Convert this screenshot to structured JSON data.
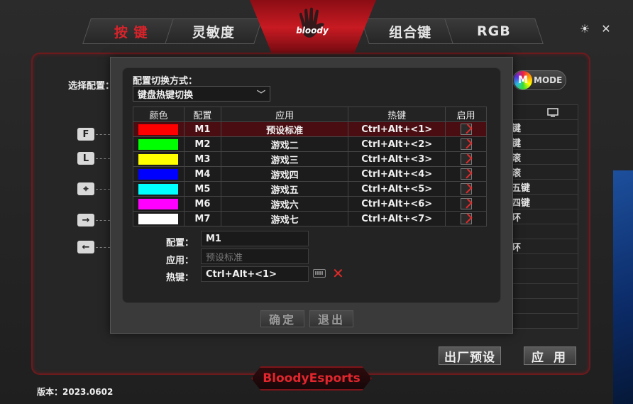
{
  "tabs": [
    {
      "label": "按 键",
      "active": true
    },
    {
      "label": "灵敏度",
      "active": false
    },
    {
      "label": "组合键",
      "active": false
    },
    {
      "label": "RGB",
      "active": false
    }
  ],
  "logo_text": "bloody",
  "select_config_label": "选择配置：",
  "side_keys": [
    "F",
    "L",
    "⌖",
    "→",
    "←"
  ],
  "mode_badge": {
    "icon": "M",
    "label": "MODE"
  },
  "right_list": [
    "键",
    "键",
    "滚",
    "滚",
    "五键",
    "四键",
    "环",
    "",
    "环",
    "",
    "",
    "",
    ""
  ],
  "factory_button": "出厂预设",
  "apply_button": "应 用",
  "brand": "BloodyEsports",
  "version": "版本：2023.0602",
  "modal": {
    "switch_mode_title": "配置切换方式：",
    "switch_mode_value": "键盘热键切换",
    "columns": [
      "颜色",
      "配置",
      "应用",
      "热键",
      "启用"
    ],
    "rows": [
      {
        "color": "#ff0000",
        "config": "M1",
        "app": "预设标准",
        "hotkey": "Ctrl+Alt+<1>",
        "enabled": true,
        "selected": true
      },
      {
        "color": "#00ff00",
        "config": "M2",
        "app": "游戏二",
        "hotkey": "Ctrl+Alt+<2>",
        "enabled": true,
        "selected": false
      },
      {
        "color": "#ffff00",
        "config": "M3",
        "app": "游戏三",
        "hotkey": "Ctrl+Alt+<3>",
        "enabled": true,
        "selected": false
      },
      {
        "color": "#0000ff",
        "config": "M4",
        "app": "游戏四",
        "hotkey": "Ctrl+Alt+<4>",
        "enabled": true,
        "selected": false
      },
      {
        "color": "#00ffff",
        "config": "M5",
        "app": "游戏五",
        "hotkey": "Ctrl+Alt+<5>",
        "enabled": true,
        "selected": false
      },
      {
        "color": "#ff00ff",
        "config": "M6",
        "app": "游戏六",
        "hotkey": "Ctrl+Alt+<6>",
        "enabled": true,
        "selected": false
      },
      {
        "color": "#ffffff",
        "config": "M7",
        "app": "游戏七",
        "hotkey": "Ctrl+Alt+<7>",
        "enabled": true,
        "selected": false
      }
    ],
    "form": {
      "config_label": "配置：",
      "config_value": "M1",
      "app_label": "应用：",
      "app_value": "预设标准",
      "hotkey_label": "热键：",
      "hotkey_value": "Ctrl+Alt+<1>"
    },
    "ok_button": "确定",
    "exit_button": "退出"
  }
}
